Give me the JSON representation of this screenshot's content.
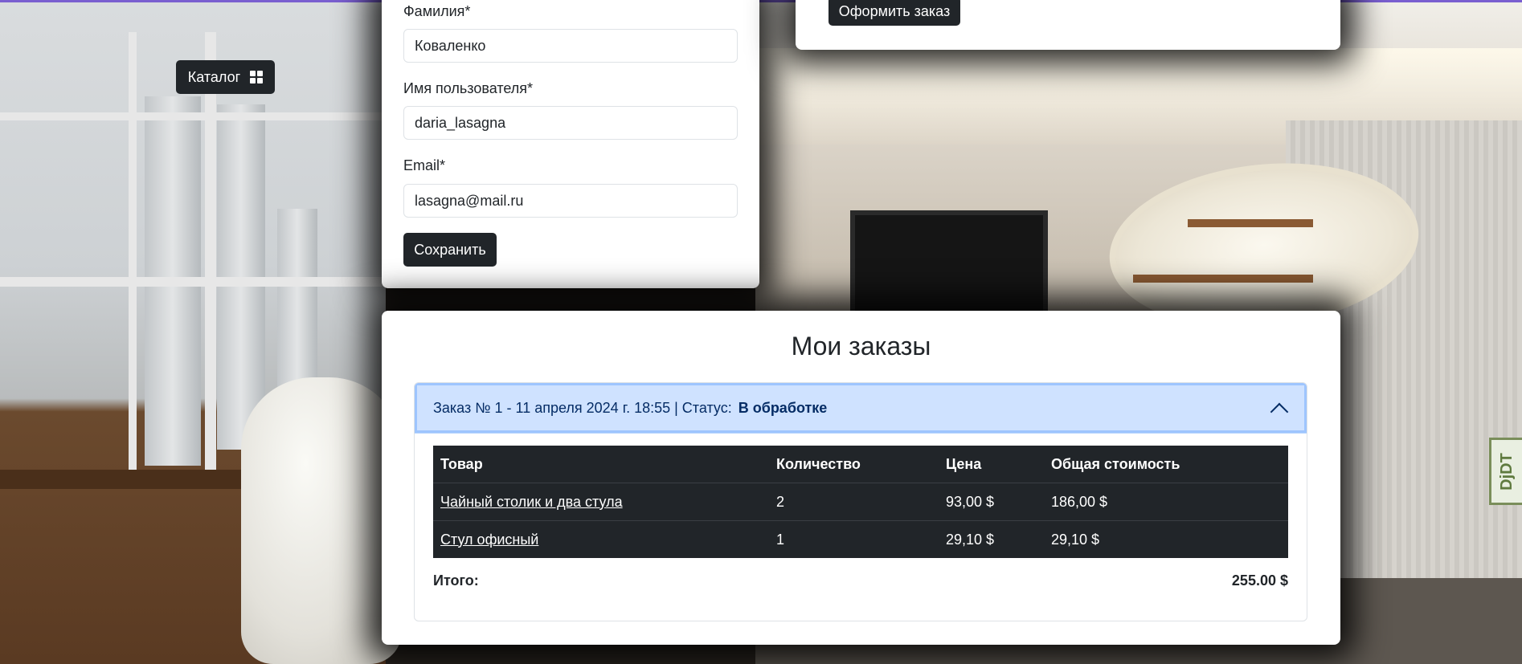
{
  "profile": {
    "last_name_label": "Фамилия*",
    "last_name_value": "Коваленко",
    "username_label": "Имя пользователя*",
    "username_value": "daria_lasagna",
    "email_label": "Email*",
    "email_value": "lasagna@mail.ru",
    "save_label": "Сохранить"
  },
  "catalog": {
    "label": "Каталог",
    "icon": "grid-icon"
  },
  "checkout": {
    "label": "Оформить заказ"
  },
  "orders": {
    "title": "Мои заказы",
    "order": {
      "summary": "Заказ № 1 - 11 апреля 2024 г. 18:55 | Статус:",
      "status": "В обработке",
      "columns": [
        "Товар",
        "Количество",
        "Цена",
        "Общая стоимость"
      ],
      "rows": [
        {
          "product": "Чайный столик и два стула",
          "quantity": "2",
          "price": "93,00 $",
          "total": "186,00 $"
        },
        {
          "product": "Стул офисный",
          "quantity": "1",
          "price": "29,10 $",
          "total": "29,10 $"
        }
      ],
      "total_label": "Итого:",
      "total_value": "255.00 $"
    }
  },
  "debug_toolbar": {
    "label": "DjDT"
  },
  "colors": {
    "accent": "#7a5fd0",
    "dark": "#212529",
    "header_bg": "#cfe2ff",
    "header_text": "#052c65"
  }
}
